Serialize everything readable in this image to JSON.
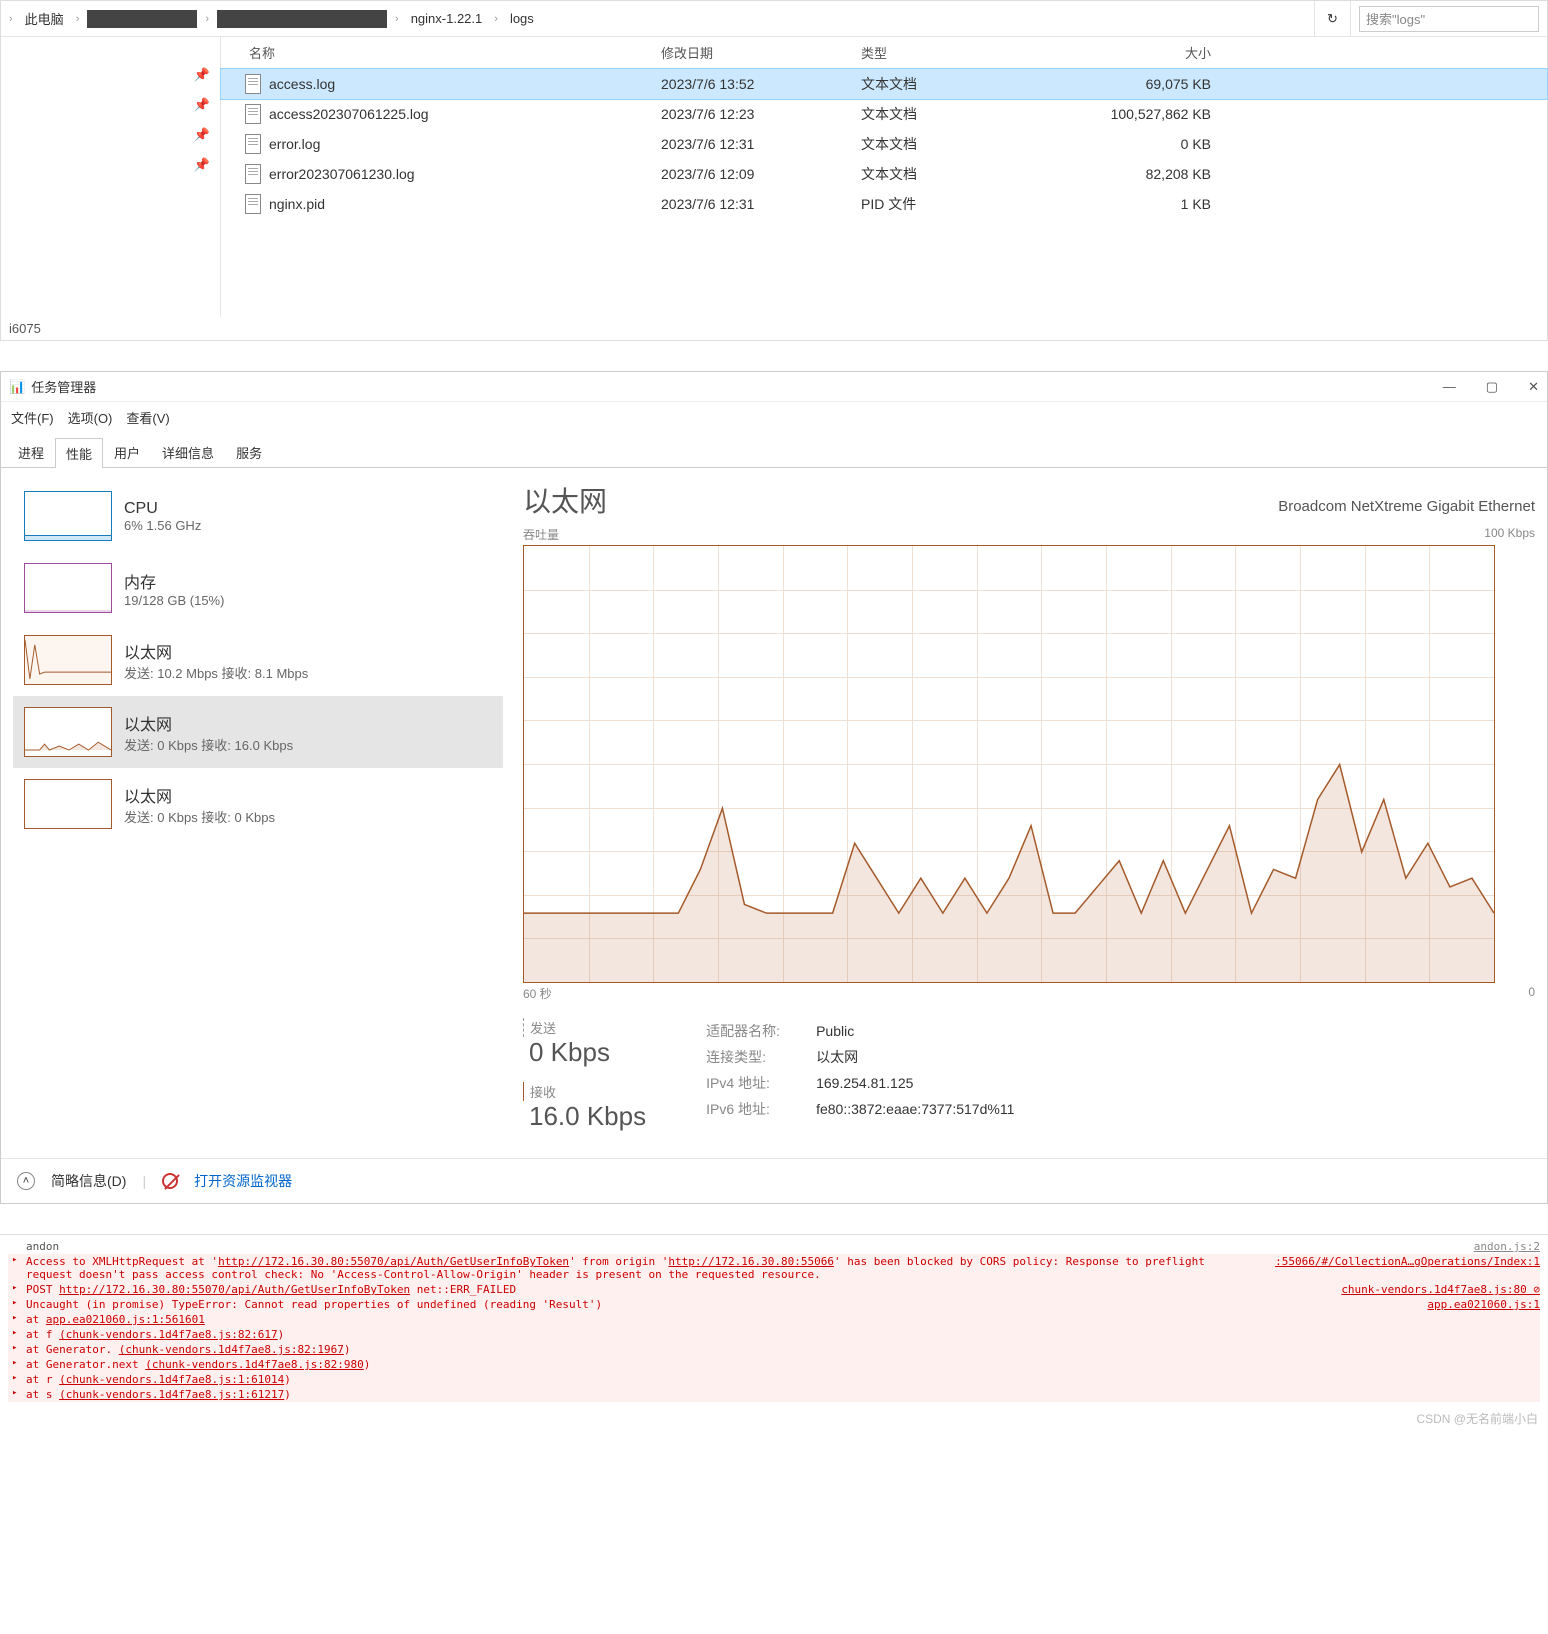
{
  "explorer": {
    "crumbs": [
      "此电脑",
      "█████",
      "███ ███ █",
      "nginx-1.22.1",
      "logs"
    ],
    "search_placeholder": "搜索\"logs\"",
    "headers": {
      "name": "名称",
      "date": "修改日期",
      "type": "类型",
      "size": "大小"
    },
    "files": [
      {
        "name": "access.log",
        "date": "2023/7/6 13:52",
        "type": "文本文档",
        "size": "69,075 KB",
        "selected": true
      },
      {
        "name": "access202307061225.log",
        "date": "2023/7/6 12:23",
        "type": "文本文档",
        "size": "100,527,862 KB",
        "selected": false
      },
      {
        "name": "error.log",
        "date": "2023/7/6 12:31",
        "type": "文本文档",
        "size": "0 KB",
        "selected": false
      },
      {
        "name": "error202307061230.log",
        "date": "2023/7/6 12:09",
        "type": "文本文档",
        "size": "82,208 KB",
        "selected": false
      },
      {
        "name": "nginx.pid",
        "date": "2023/7/6 12:31",
        "type": "PID 文件",
        "size": "1 KB",
        "selected": false
      }
    ],
    "status": "i6075"
  },
  "taskmgr": {
    "title": "任务管理器",
    "menu": [
      "文件(F)",
      "选项(O)",
      "查看(V)"
    ],
    "tabs": [
      "进程",
      "性能",
      "用户",
      "详细信息",
      "服务"
    ],
    "active_tab": 1,
    "side": [
      {
        "title": "CPU",
        "sub": "6%  1.56 GHz",
        "thumb": "cpu"
      },
      {
        "title": "内存",
        "sub": "19/128 GB (15%)",
        "thumb": "mem"
      },
      {
        "title": "以太网",
        "sub": "发送: 10.2 Mbps 接收: 8.1 Mbps",
        "thumb": "eth1"
      },
      {
        "title": "以太网",
        "sub": "发送: 0 Kbps 接收: 16.0 Kbps",
        "thumb": "eth2",
        "selected": true
      },
      {
        "title": "以太网",
        "sub": "发送: 0 Kbps 接收: 0 Kbps",
        "thumb": "eth3"
      }
    ],
    "main": {
      "title": "以太网",
      "adapter": "Broadcom NetXtreme Gigabit Ethernet",
      "y_label": "吞吐量",
      "y_max": "100 Kbps",
      "x_left": "60 秒",
      "x_right": "0",
      "send_label": "发送",
      "send_val": "0 Kbps",
      "recv_label": "接收",
      "recv_val": "16.0 Kbps",
      "details": [
        {
          "k": "适配器名称:",
          "v": "Public"
        },
        {
          "k": "连接类型:",
          "v": "以太网"
        },
        {
          "k": "IPv4 地址:",
          "v": "169.254.81.125"
        },
        {
          "k": "IPv6 地址:",
          "v": "fe80::3872:eaae:7377:517d%11"
        }
      ]
    },
    "footer": {
      "brief": "简略信息(D)",
      "monitor": "打开资源监视器"
    }
  },
  "console": {
    "rows": [
      {
        "type": "plain",
        "msg": "andon",
        "src": "andon.js:2"
      },
      {
        "type": "err",
        "msg": "Access to XMLHttpRequest at 'http://172.16.30.80:55070/api/Auth/GetUserInfoByToken' from origin 'http://172.16.30.80:55066' has been blocked by CORS policy: Response to preflight request doesn't pass access control check: No 'Access-Control-Allow-Origin' header is present on the requested resource.",
        "src": ":55066/#/CollectionA…gOperations/Index:1"
      },
      {
        "type": "err",
        "msg": "POST http://172.16.30.80:55070/api/Auth/GetUserInfoByToken net::ERR_FAILED",
        "src": "chunk-vendors.1d4f7ae8.js:80 ⊘"
      },
      {
        "type": "err",
        "msg": "Uncaught (in promise) TypeError: Cannot read properties of undefined (reading 'Result')",
        "src": "app.ea021060.js:1"
      }
    ],
    "stack": [
      "at app.ea021060.js:1:561601",
      "at f (chunk-vendors.1d4f7ae8.js:82:617)",
      "at Generator.<anonymous> (chunk-vendors.1d4f7ae8.js:82:1967)",
      "at Generator.next (chunk-vendors.1d4f7ae8.js:82:980)",
      "at r (chunk-vendors.1d4f7ae8.js:1:61014)",
      "at s (chunk-vendors.1d4f7ae8.js:1:61217)"
    ]
  },
  "chart_data": {
    "type": "area",
    "title": "以太网",
    "xlabel": "60 秒 → 0",
    "ylabel": "吞吐量",
    "ylim": [
      0,
      100
    ],
    "unit": "Kbps",
    "series": [
      {
        "name": "接收",
        "values": [
          16,
          16,
          16,
          16,
          16,
          16,
          16,
          16,
          26,
          40,
          18,
          16,
          16,
          16,
          16,
          32,
          24,
          16,
          24,
          16,
          24,
          16,
          24,
          36,
          16,
          16,
          22,
          28,
          16,
          28,
          16,
          26,
          36,
          16,
          26,
          24,
          42,
          50,
          30,
          42,
          24,
          32,
          22,
          24,
          16
        ]
      }
    ]
  },
  "watermark": "CSDN @无名前端小白"
}
